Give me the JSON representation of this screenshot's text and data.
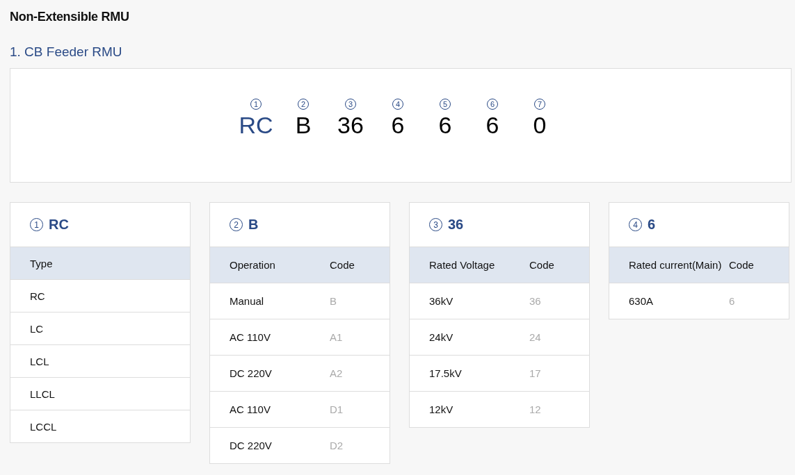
{
  "page_title": "Non-Extensible RMU",
  "section_title": "1. CB Feeder RMU",
  "code_segments": [
    {
      "number": "1",
      "value": "RC",
      "highlighted": true
    },
    {
      "number": "2",
      "value": "B",
      "highlighted": false
    },
    {
      "number": "3",
      "value": "36",
      "highlighted": false
    },
    {
      "number": "4",
      "value": "6",
      "highlighted": false
    },
    {
      "number": "5",
      "value": "6",
      "highlighted": false
    },
    {
      "number": "6",
      "value": "6",
      "highlighted": false
    },
    {
      "number": "7",
      "value": "0",
      "highlighted": false
    }
  ],
  "tables": [
    {
      "number": "1",
      "title": "RC",
      "columns": [
        "Type"
      ],
      "rows": [
        [
          "RC"
        ],
        [
          "LC"
        ],
        [
          "LCL"
        ],
        [
          "LLCL"
        ],
        [
          "LCCL"
        ]
      ]
    },
    {
      "number": "2",
      "title": "B",
      "columns": [
        "Operation",
        "Code"
      ],
      "rows": [
        [
          "Manual",
          "B"
        ],
        [
          "AC 110V",
          "A1"
        ],
        [
          "DC 220V",
          "A2"
        ],
        [
          "AC 110V",
          "D1"
        ],
        [
          "DC 220V",
          "D2"
        ]
      ]
    },
    {
      "number": "3",
      "title": "36",
      "columns": [
        "Rated Voltage",
        "Code"
      ],
      "rows": [
        [
          "36kV",
          "36"
        ],
        [
          "24kV",
          "24"
        ],
        [
          "17.5kV",
          "17"
        ],
        [
          "12kV",
          "12"
        ]
      ]
    },
    {
      "number": "4",
      "title": "6",
      "columns": [
        "Rated current(Main)",
        "Code"
      ],
      "rows": [
        [
          "630A",
          "6"
        ]
      ]
    }
  ]
}
